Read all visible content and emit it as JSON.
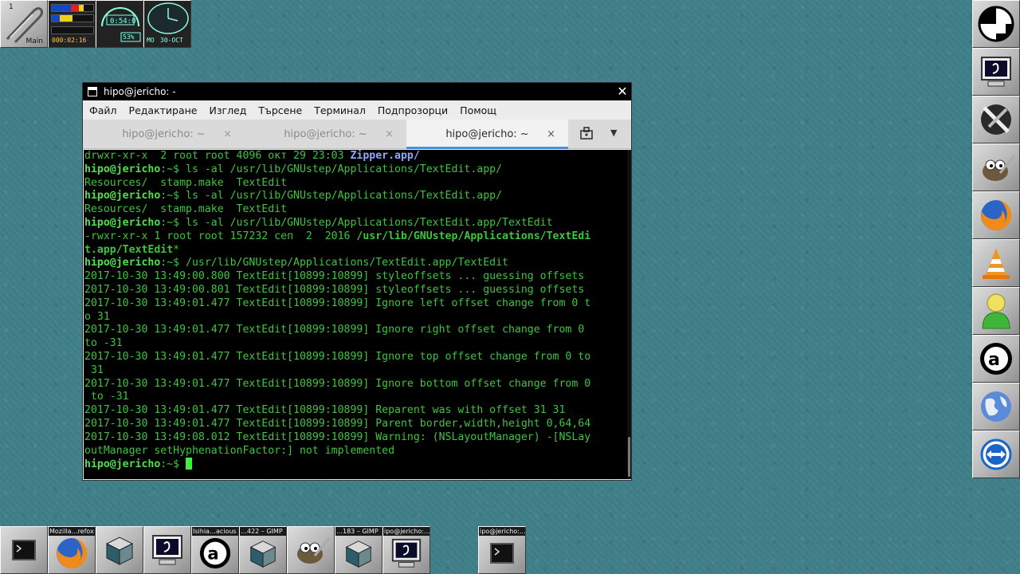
{
  "top_dock": {
    "workspace_number": "1",
    "workspace_name": "Main",
    "load_clock": "000:02:16",
    "battery_percent": "53%",
    "clock_day": "MO",
    "clock_date": "30-OCT"
  },
  "terminal": {
    "title": "hipo@jericho: -",
    "menu": [
      "Файл",
      "Редактиране",
      "Изглед",
      "Търсене",
      "Терминал",
      "Подпрозорци",
      "Помощ"
    ],
    "tabs": [
      {
        "label": "hipo@jericho: ~",
        "close": "×"
      },
      {
        "label": "hipo@jericho: ~",
        "close": "×"
      },
      {
        "label": "hipo@jericho: ~",
        "close": "×"
      }
    ],
    "prompt": "hipo@jericho",
    "lines": {
      "l1a": "drwxr-xr-x  2 root root 4096 окт 29 23:03 ",
      "l1b": "Zipper.app/",
      "l2": ":~$ ls -al /usr/lib/GNUstep/Applications/TextEdit.app/",
      "l3": "Resources/  stamp.make  TextEdit",
      "l4": ":~$ ls -al /usr/lib/GNUstep/Applications/TextEdit.app/",
      "l5": "Resources/  stamp.make  TextEdit",
      "l6": ":~$ ls -al /usr/lib/GNUstep/Applications/TextEdit.app/TextEdit",
      "l7a": "-rwxr-xr-x 1 root root 157232 сеп  2  2016 ",
      "l7b": "/usr/lib/GNUstep/Applications/TextEdi",
      "l8": "t.app/TextEdit",
      "l8b": "*",
      "l9": ":~$ /usr/lib/GNUstep/Applications/TextEdit.app/TextEdit",
      "l10": "2017-10-30 13:49:00.800 TextEdit[10899:10899] styleoffsets ... guessing offsets",
      "l11": "2017-10-30 13:49:00.801 TextEdit[10899:10899] styleoffsets ... guessing offsets",
      "l12": "2017-10-30 13:49:01.477 TextEdit[10899:10899] Ignore left offset change from 0 t",
      "l13": "o 31",
      "l14": "2017-10-30 13:49:01.477 TextEdit[10899:10899] Ignore right offset change from 0",
      "l15": "to -31",
      "l16": "2017-10-30 13:49:01.477 TextEdit[10899:10899] Ignore top offset change from 0 to",
      "l17": " 31",
      "l18": "2017-10-30 13:49:01.477 TextEdit[10899:10899] Ignore bottom offset change from 0",
      "l19": " to -31",
      "l20": "2017-10-30 13:49:01.477 TextEdit[10899:10899] Reparent was with offset 31 31",
      "l21": "2017-10-30 13:49:01.477 TextEdit[10899:10899] Parent border,width,height 0,64,64",
      "l22": "2017-10-30 13:49:08.012 TextEdit[10899:10899] Warning: (NSLayoutManager) -[NSLay",
      "l23": "outManager setHyphenationFactor:] not implemented",
      "l24": ":~$ "
    }
  },
  "bottom_dock": {
    "captions": [
      "Mozilla…refox",
      "Isihia…acious",
      "…422 – GIMP",
      "…183 – GIMP",
      "ipo@jericho:…",
      "ipo@jericho:…"
    ]
  },
  "colors": {
    "desktop": "#3f7f89",
    "terminal_bg": "#000000",
    "terminal_fg": "#3ec43e",
    "tab_accent": "#4a90d9"
  }
}
